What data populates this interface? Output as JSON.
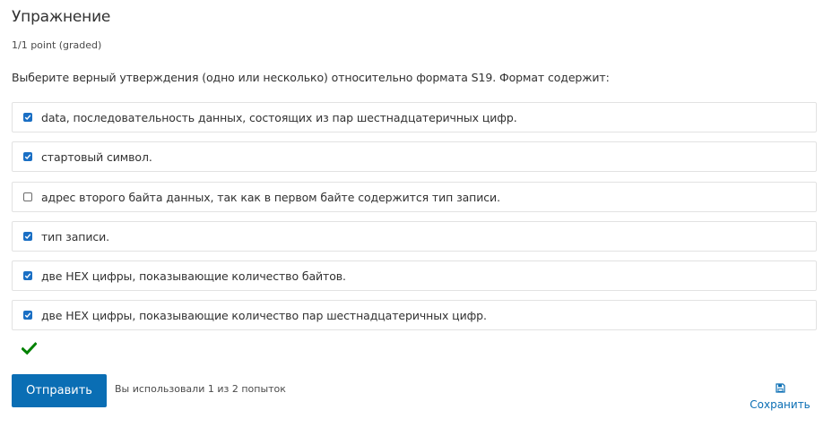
{
  "header": {
    "title": "Упражнение",
    "points": "1/1 point (graded)"
  },
  "question": {
    "prompt": "Выберите верный утверждения (одно или несколько) относительно формата S19. Формат содержит:",
    "options": [
      {
        "label": "data, последовательность данных, состоящих из пар шестнадцатеричных цифр.",
        "checked": true
      },
      {
        "label": "стартовый символ.",
        "checked": true
      },
      {
        "label": "адрес второго байта данных, так как в первом байте содержится тип записи.",
        "checked": false
      },
      {
        "label": "тип записи.",
        "checked": true
      },
      {
        "label": "две HEX цифры, показывающие количество байтов.",
        "checked": true
      },
      {
        "label": "две HEX цифры, показывающие количество пар шестнадцатеричных цифр.",
        "checked": true
      }
    ]
  },
  "status": {
    "icon": "checkmark-icon",
    "color": "#008100"
  },
  "actions": {
    "submit_label": "Отправить",
    "attempts_text": "Вы использовали 1 из 2 попыток",
    "save_label": "Сохранить",
    "save_icon": "floppy-disk-icon"
  },
  "colors": {
    "accent": "#0a6eb4",
    "checkbox": "#1a6fc4",
    "correct": "#008100"
  }
}
